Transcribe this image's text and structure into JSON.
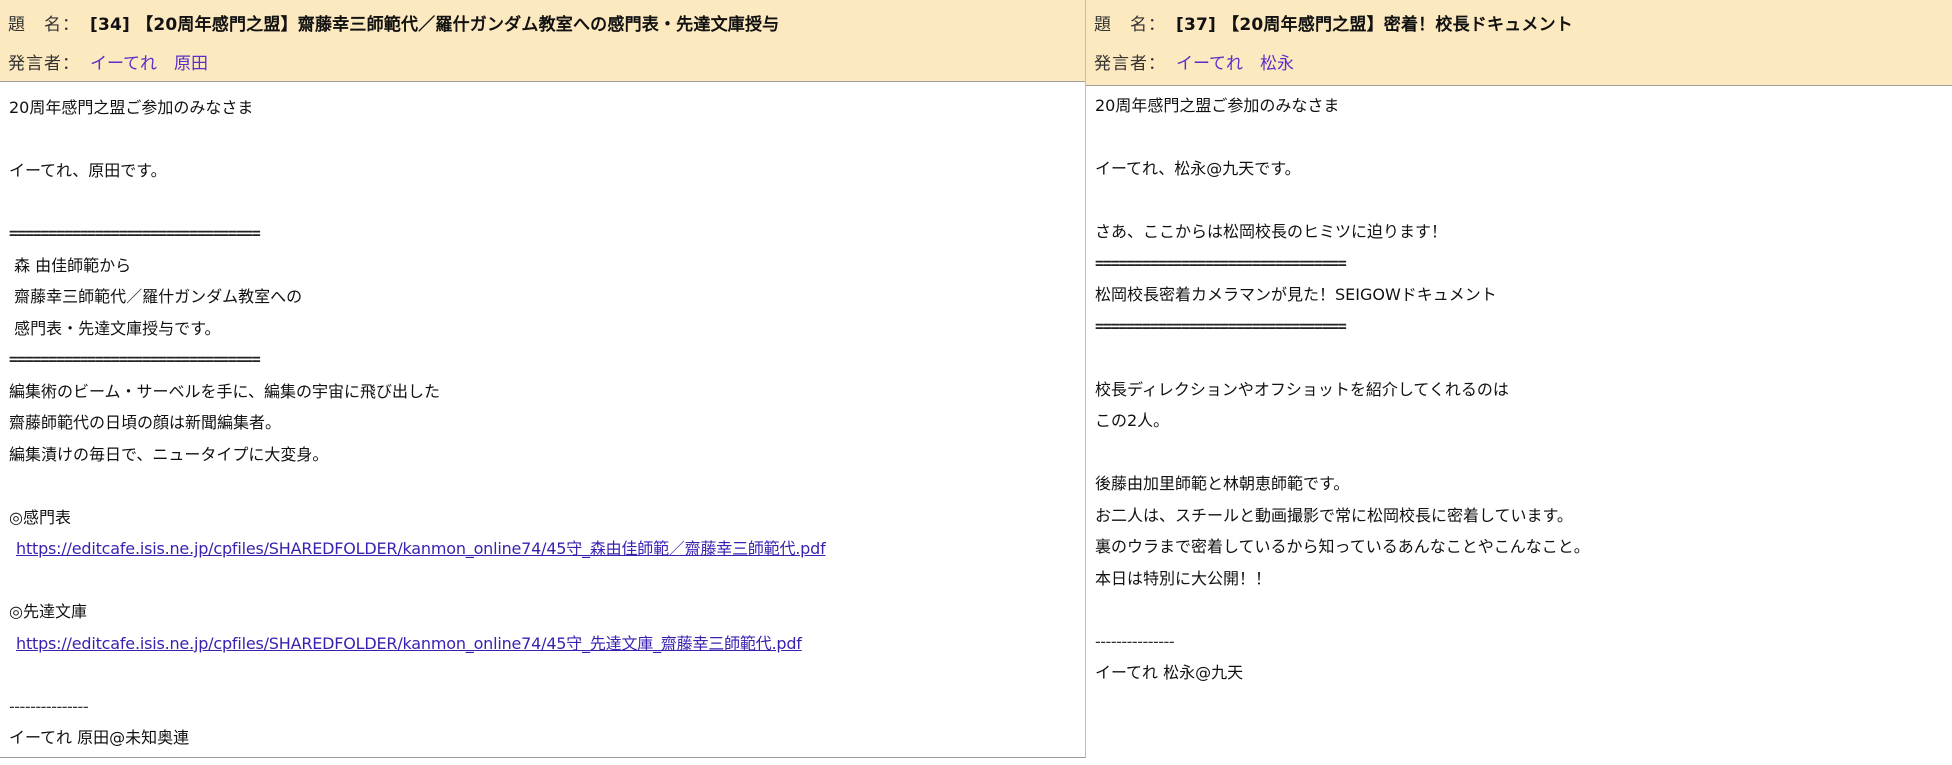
{
  "labels": {
    "subject": "題　名：",
    "author": "発言者："
  },
  "posts": [
    {
      "subject": "[34] 【20周年感門之盟】齋藤幸三師範代／羅什ガンダム教室への感門表・先達文庫授与",
      "author": "イーてれ　原田",
      "lines": [
        {
          "type": "text",
          "text": "20周年感門之盟ご参加のみなさま"
        },
        {
          "type": "blank",
          "text": ""
        },
        {
          "type": "text",
          "text": "イーてれ、原田です。"
        },
        {
          "type": "blank",
          "text": ""
        },
        {
          "type": "rule",
          "text": "================================"
        },
        {
          "type": "text",
          "text": " 森 由佳師範から"
        },
        {
          "type": "text",
          "text": " 齋藤幸三師範代／羅什ガンダム教室への"
        },
        {
          "type": "text",
          "text": " 感門表・先達文庫授与です。"
        },
        {
          "type": "rule",
          "text": "================================"
        },
        {
          "type": "text",
          "text": "編集術のビーム・サーベルを手に、編集の宇宙に飛び出した"
        },
        {
          "type": "text",
          "text": "齋藤師範代の日頃の顔は新聞編集者。"
        },
        {
          "type": "text",
          "text": "編集漬けの毎日で、ニュータイプに大変身。"
        },
        {
          "type": "blank",
          "text": ""
        },
        {
          "type": "text",
          "text": "◎感門表"
        },
        {
          "type": "link",
          "text": "https://editcafe.isis.ne.jp/cpfiles/SHAREDFOLDER/kanmon_online74/45守_森由佳師範／齋藤幸三師範代.pdf"
        },
        {
          "type": "blank",
          "text": ""
        },
        {
          "type": "text",
          "text": "◎先達文庫"
        },
        {
          "type": "link",
          "text": "https://editcafe.isis.ne.jp/cpfiles/SHAREDFOLDER/kanmon_online74/45守_先達文庫_齋藤幸三師範代.pdf"
        },
        {
          "type": "blank",
          "text": ""
        },
        {
          "type": "sig-sep",
          "text": "---------------"
        },
        {
          "type": "text",
          "text": "イーてれ 原田@未知奥連"
        }
      ]
    },
    {
      "subject": "[37] 【20周年感門之盟】密着！校長ドキュメント",
      "author": "イーてれ　松永",
      "lines": [
        {
          "type": "text",
          "text": "20周年感門之盟ご参加のみなさま"
        },
        {
          "type": "blank",
          "text": ""
        },
        {
          "type": "text",
          "text": "イーてれ、松永@九天です。"
        },
        {
          "type": "blank",
          "text": ""
        },
        {
          "type": "text",
          "text": "さあ、ここからは松岡校長のヒミツに迫ります！"
        },
        {
          "type": "rule",
          "text": "================================"
        },
        {
          "type": "text",
          "text": "松岡校長密着カメラマンが見た！SEIGOWドキュメント"
        },
        {
          "type": "rule",
          "text": "================================"
        },
        {
          "type": "blank",
          "text": ""
        },
        {
          "type": "text",
          "text": "校長ディレクションやオフショットを紹介してくれるのは"
        },
        {
          "type": "text",
          "text": "この2人。"
        },
        {
          "type": "blank",
          "text": ""
        },
        {
          "type": "text",
          "text": "後藤由加里師範と林朝恵師範です。"
        },
        {
          "type": "text",
          "text": "お二人は、スチールと動画撮影で常に松岡校長に密着しています。"
        },
        {
          "type": "text",
          "text": "裏のウラまで密着しているから知っているあんなことやこんなこと。"
        },
        {
          "type": "text",
          "text": "本日は特別に大公開！！"
        },
        {
          "type": "blank",
          "text": ""
        },
        {
          "type": "sig-sep",
          "text": "---------------"
        },
        {
          "type": "text",
          "text": "イーてれ 松永@九天"
        }
      ]
    }
  ]
}
